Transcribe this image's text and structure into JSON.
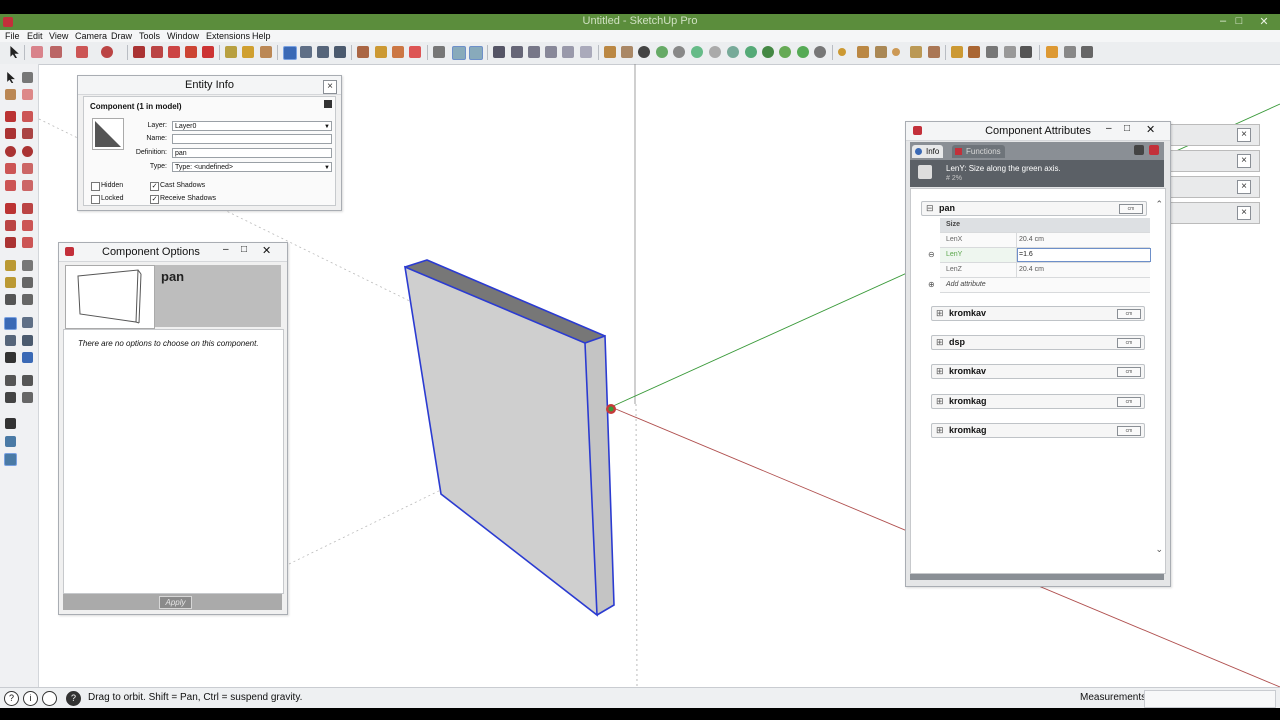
{
  "window": {
    "title": "Untitled - SketchUp Pro",
    "minimize_glyph": "‒",
    "maximize_glyph": "□",
    "close_glyph": "✕"
  },
  "menu": [
    "File",
    "Edit",
    "View",
    "Camera",
    "Draw",
    "Tools",
    "Window",
    "Extensions",
    "Help"
  ],
  "colors": {
    "axis_red": "#b0504f",
    "axis_green": "#3a9a3a",
    "model_edge": "#2b3bd1",
    "model_face": "#cfcfcf",
    "title_green": "#5b8d3c"
  },
  "entity_info": {
    "title": "Entity Info",
    "heading": "Component (1 in model)",
    "labels": {
      "layer": "Layer:",
      "name": "Name:",
      "definition": "Definition:",
      "type": "Type:"
    },
    "layer": "Layer0",
    "name": "",
    "definition": "pan",
    "type": "Type: <undefined>",
    "hidden_label": "Hidden",
    "locked_label": "Locked",
    "cast_shadows_label": "Cast Shadows",
    "receive_shadows_label": "Receive Shadows",
    "hidden_checked": false,
    "locked_checked": false,
    "cast_shadows_checked": true,
    "receive_shadows_checked": true,
    "check_glyph": "✓"
  },
  "component_options": {
    "title": "Component Options",
    "name": "pan",
    "message": "There are no options to choose on this component.",
    "apply_label": "Apply"
  },
  "component_attributes": {
    "title": "Component Attributes",
    "tabs": [
      "Info",
      "Functions"
    ],
    "desc_text": "LenY:  Size along the green axis.",
    "desc_sub": "# 2%",
    "top_component": {
      "name": "pan",
      "expander": "⊟",
      "unit": "cm",
      "section": "Size",
      "attributes": [
        {
          "name": "LenX",
          "value": "20.4 cm"
        },
        {
          "name": "LenY",
          "value": "=1.6"
        },
        {
          "name": "LenZ",
          "value": "20.4 cm"
        }
      ],
      "add_attribute": "Add attribute"
    },
    "subcomponents": [
      {
        "name": "kromkav",
        "unit": "cm"
      },
      {
        "name": "dsp",
        "unit": "cm"
      },
      {
        "name": "kromkav",
        "unit": "cm"
      },
      {
        "name": "kromkag",
        "unit": "cm"
      },
      {
        "name": "kromkag",
        "unit": "cm"
      }
    ],
    "expander_collapsed": "⊞"
  },
  "status": {
    "text": "Drag to orbit. Shift = Pan, Ctrl = suspend gravity.",
    "measurements_label": "Measurements",
    "measurements_value": ""
  },
  "status_icons": [
    "?",
    "i",
    "user-icon",
    "help-icon"
  ]
}
